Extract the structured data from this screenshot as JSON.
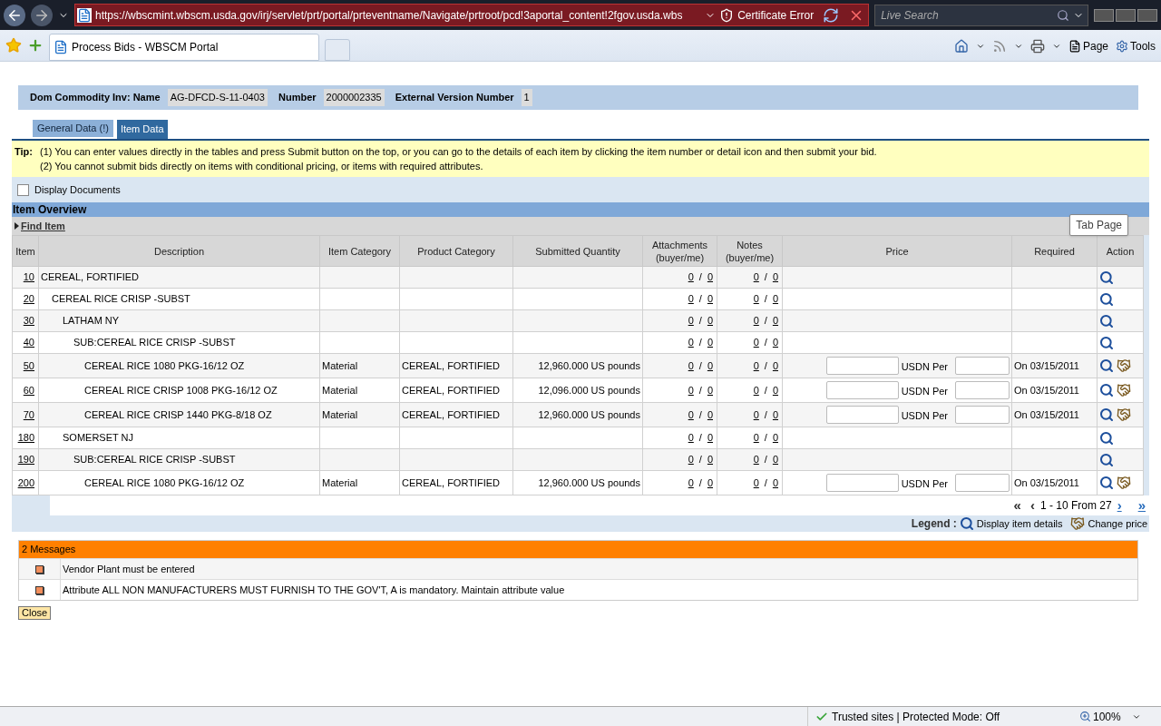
{
  "browser": {
    "address": "https://wbscmint.wbscm.usda.gov/irj/servlet/prt/portal/prteventname/Navigate/prtroot/pcd!3aportal_content!2fgov.usda.wbs",
    "certificate": "Certificate Error",
    "search": {
      "placeholder": "Live Search"
    },
    "tab": "Process Bids - WBSCM Portal",
    "page_menu": "Page",
    "tools_menu": "Tools"
  },
  "header": {
    "fields": [
      {
        "label": "Dom Commodity Inv: Name",
        "value": "AG-DFCD-S-11-0403"
      },
      {
        "label": "Number",
        "value": "2000002335"
      },
      {
        "label": "External Version Number",
        "value": "1"
      }
    ]
  },
  "tabs": [
    {
      "label": "General Data (!)",
      "selected": false
    },
    {
      "label": "Item Data",
      "selected": true
    }
  ],
  "tip": {
    "label": "Tip:",
    "lines": [
      "(1) You can enter values directly in the tables and press Submit button on the top, or you can go to the details of each item by clicking the item number or detail icon and then submit your bid.",
      "(2) You cannot submit bids directly on items with conditional pricing, or items with required attributes."
    ]
  },
  "display_documents": {
    "label": "Display Documents",
    "checked": false
  },
  "overview": {
    "title": "Item Overview",
    "find_item": "Find Item",
    "tooltip": "Tab Page"
  },
  "table": {
    "columns": [
      "Item",
      "Description",
      "Item Category",
      "Product Category",
      "Submitted Quantity",
      "Attachments (buyer/me)",
      "Notes (buyer/me)",
      "Price",
      "Required",
      "Action"
    ],
    "rows": [
      {
        "kind": "group",
        "item": "10",
        "description": "CEREAL, FORTIFIED",
        "attachments": [
          "0",
          "/",
          "0"
        ],
        "notes": [
          "0",
          "/",
          "0"
        ],
        "children": [
          {
            "kind": "group",
            "item": "20",
            "description": "CEREAL RICE CRISP -SUBST",
            "attachments": [
              "0",
              "/",
              "0"
            ],
            "notes": [
              "0",
              "/",
              "0"
            ],
            "children": [
              {
                "kind": "group",
                "item": "30",
                "description": "LATHAM NY",
                "attachments": [
                  "0",
                  "/",
                  "0"
                ],
                "notes": [
                  "0",
                  "/",
                  "0"
                ],
                "children": [
                  {
                    "kind": "group",
                    "item": "40",
                    "description": "SUB:CEREAL RICE CRISP -SUBST",
                    "attachments": [
                      "0",
                      "/",
                      "0"
                    ],
                    "notes": [
                      "0",
                      "/",
                      "0"
                    ],
                    "children": [
                      {
                        "kind": "material",
                        "item": "50",
                        "description": "CEREAL RICE 1080 PKG-16/12 OZ",
                        "item_category": "Material",
                        "product_category": "CEREAL, FORTIFIED",
                        "quantity": "12,960.000 US pounds",
                        "attachments": [
                          "0",
                          "/",
                          "0"
                        ],
                        "notes": [
                          "0",
                          "/",
                          "0"
                        ],
                        "price_unit": "USDN Per",
                        "required": "On 03/15/2011"
                      },
                      {
                        "kind": "material",
                        "item": "60",
                        "description": "CEREAL RICE CRISP 1008 PKG-16/12 OZ",
                        "item_category": "Material",
                        "product_category": "CEREAL, FORTIFIED",
                        "quantity": "12,096.000 US pounds",
                        "attachments": [
                          "0",
                          "/",
                          "0"
                        ],
                        "notes": [
                          "0",
                          "/",
                          "0"
                        ],
                        "price_unit": "USDN Per",
                        "required": "On 03/15/2011"
                      },
                      {
                        "kind": "material",
                        "item": "70",
                        "description": "CEREAL RICE CRISP 1440 PKG-8/18 OZ",
                        "item_category": "Material",
                        "product_category": "CEREAL, FORTIFIED",
                        "quantity": "12,960.000 US pounds",
                        "attachments": [
                          "0",
                          "/",
                          "0"
                        ],
                        "notes": [
                          "0",
                          "/",
                          "0"
                        ],
                        "price_unit": "USDN Per",
                        "required": "On 03/15/2011"
                      }
                    ]
                  }
                ]
              },
              {
                "kind": "group",
                "item": "180",
                "description": "SOMERSET NJ",
                "attachments": [
                  "0",
                  "/",
                  "0"
                ],
                "notes": [
                  "0",
                  "/",
                  "0"
                ],
                "children": [
                  {
                    "kind": "group",
                    "item": "190",
                    "description": "SUB:CEREAL RICE CRISP -SUBST",
                    "attachments": [
                      "0",
                      "/",
                      "0"
                    ],
                    "notes": [
                      "0",
                      "/",
                      "0"
                    ],
                    "children": [
                      {
                        "kind": "material",
                        "item": "200",
                        "description": "CEREAL RICE 1080 PKG-16/12 OZ",
                        "item_category": "Material",
                        "product_category": "CEREAL, FORTIFIED",
                        "quantity": "12,960.000 US pounds",
                        "attachments": [
                          "0",
                          "/",
                          "0"
                        ],
                        "notes": [
                          "0",
                          "/",
                          "0"
                        ],
                        "price_unit": "USDN Per",
                        "required": "On 03/15/2011"
                      }
                    ]
                  }
                ]
              }
            ]
          }
        ]
      }
    ]
  },
  "pager": {
    "first": {
      "label": "«",
      "disabled": true
    },
    "prev": {
      "label": "‹",
      "disabled": true
    },
    "range": "1 - 10 From 27",
    "next": {
      "label": "›",
      "disabled": false
    },
    "last": {
      "label": "»",
      "disabled": false
    }
  },
  "legend": {
    "label": "Legend :",
    "items": [
      {
        "kind": "details",
        "text": "Display item details"
      },
      {
        "kind": "price",
        "text": "Change price"
      }
    ]
  },
  "messages": {
    "title": "2 Messages",
    "items": [
      "Vendor Plant must be entered",
      "Attribute ALL NON MANUFACTURERS MUST FURNISH TO THE GOV'T, A is mandatory. Maintain attribute value"
    ],
    "close": "Close"
  },
  "status_bar": {
    "zone": "Trusted sites | Protected Mode: Off",
    "zoom": "100%"
  }
}
